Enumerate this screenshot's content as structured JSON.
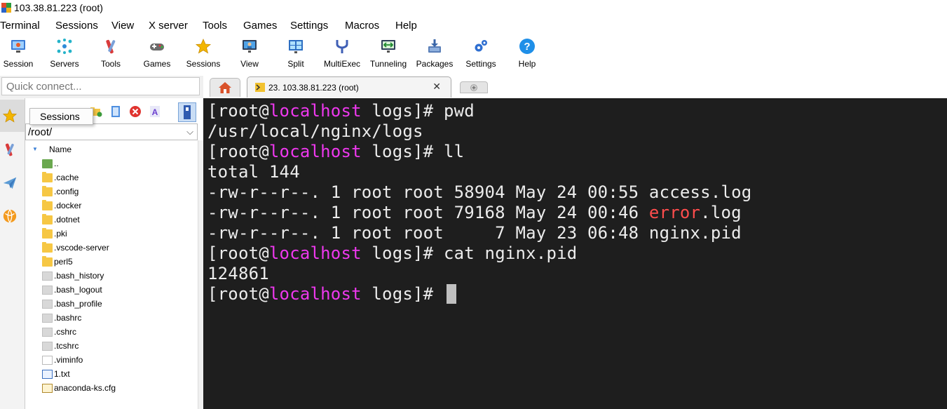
{
  "window": {
    "title": "103.38.81.223 (root)"
  },
  "menu": [
    "Terminal",
    "Sessions",
    "View",
    "X server",
    "Tools",
    "Games",
    "Settings",
    "Macros",
    "Help"
  ],
  "toolbar": [
    {
      "label": "Session",
      "icon": "monitor-session-icon"
    },
    {
      "label": "Servers",
      "icon": "servers-network-icon"
    },
    {
      "label": "Tools",
      "icon": "tools-icon"
    },
    {
      "label": "Games",
      "icon": "gamepad-icon"
    },
    {
      "label": "Sessions",
      "icon": "star-icon"
    },
    {
      "label": "View",
      "icon": "view-monitor-icon"
    },
    {
      "label": "Split",
      "icon": "split-screen-icon"
    },
    {
      "label": "MultiExec",
      "icon": "multiexec-fork-icon"
    },
    {
      "label": "Tunneling",
      "icon": "tunneling-icon"
    },
    {
      "label": "Packages",
      "icon": "packages-download-icon"
    },
    {
      "label": "Settings",
      "icon": "gears-icon"
    },
    {
      "label": "Help",
      "icon": "help-question-icon"
    }
  ],
  "quick_connect": {
    "placeholder": "Quick connect..."
  },
  "tabs": {
    "session_tab": "23. 103.38.81.223 (root)"
  },
  "sidebar": {
    "tooltip": "Sessions",
    "path": "/root/",
    "column": "Name",
    "files": [
      {
        "name": "..",
        "kind": "up"
      },
      {
        "name": ".cache",
        "kind": "folder"
      },
      {
        "name": ".config",
        "kind": "folder"
      },
      {
        "name": ".docker",
        "kind": "folder"
      },
      {
        "name": ".dotnet",
        "kind": "folder"
      },
      {
        "name": ".pki",
        "kind": "folder"
      },
      {
        "name": ".vscode-server",
        "kind": "folder"
      },
      {
        "name": "perl5",
        "kind": "folder"
      },
      {
        "name": ".bash_history",
        "kind": "dotfile"
      },
      {
        "name": ".bash_logout",
        "kind": "dotfile"
      },
      {
        "name": ".bash_profile",
        "kind": "dotfile"
      },
      {
        "name": ".bashrc",
        "kind": "dotfile"
      },
      {
        "name": ".cshrc",
        "kind": "dotfile"
      },
      {
        "name": ".tcshrc",
        "kind": "dotfile"
      },
      {
        "name": ".viminfo",
        "kind": "plain"
      },
      {
        "name": "1.txt",
        "kind": "text"
      },
      {
        "name": "anaconda-ks.cfg",
        "kind": "cfg"
      }
    ]
  },
  "terminal": {
    "prompt_open": "[root@",
    "prompt_host": "localhost",
    "prompt_dir": " logs]# ",
    "lines": [
      {
        "type": "prompt",
        "cmd": "pwd"
      },
      {
        "type": "out",
        "text": "/usr/local/nginx/logs"
      },
      {
        "type": "prompt",
        "cmd": "ll"
      },
      {
        "type": "out",
        "text": "total 144"
      },
      {
        "type": "ls",
        "text": "-rw-r--r--. 1 root root 58904 May 24 00:55 ",
        "file": "access.log"
      },
      {
        "type": "lserr",
        "text": "-rw-r--r--. 1 root root 79168 May 24 00:46 ",
        "err": "error",
        "rest": ".log"
      },
      {
        "type": "ls",
        "text": "-rw-r--r--. 1 root root     7 May 23 06:48 ",
        "file": "nginx.pid"
      },
      {
        "type": "prompt",
        "cmd": "cat nginx.pid"
      },
      {
        "type": "out",
        "text": "124861"
      },
      {
        "type": "prompt",
        "cmd": "",
        "cursor": true
      }
    ]
  },
  "colors": {
    "terminal_bg": "#1e1e1e",
    "host": "#ee38ee",
    "error": "#ff4d4d",
    "folder": "#f6c744"
  }
}
